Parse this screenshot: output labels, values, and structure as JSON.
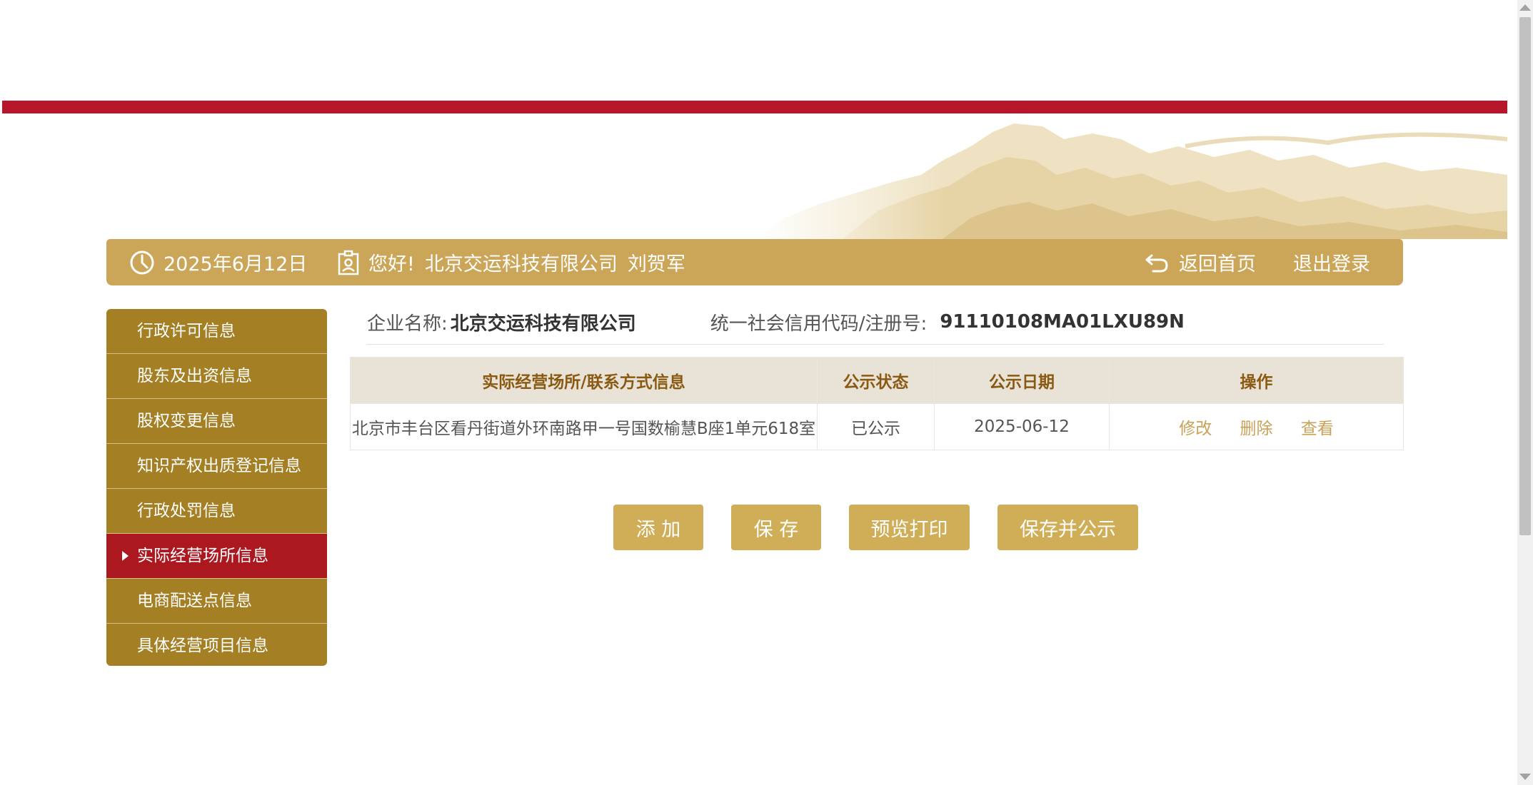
{
  "header": {
    "date": "2025年6月12日",
    "greeting": "您好!",
    "company": "北京交运科技有限公司",
    "user": "刘贺军",
    "home_label": "返回首页",
    "logout_label": "退出登录"
  },
  "sidebar": {
    "items": [
      {
        "label": "行政许可信息"
      },
      {
        "label": "股东及出资信息"
      },
      {
        "label": "股权变更信息"
      },
      {
        "label": "知识产权出质登记信息"
      },
      {
        "label": "行政处罚信息"
      },
      {
        "label": "实际经营场所信息"
      },
      {
        "label": "电商配送点信息"
      },
      {
        "label": "具体经营项目信息"
      }
    ],
    "active_index": 5
  },
  "company_info": {
    "name_label": "企业名称:",
    "name_value": "北京交运科技有限公司",
    "code_label": "统一社会信用代码/注册号:",
    "code_value": "91110108MA01LXU89N"
  },
  "table": {
    "headers": [
      "实际经营场所/联系方式信息",
      "公示状态",
      "公示日期",
      "操作"
    ],
    "rows": [
      {
        "address": "北京市丰台区看丹街道外环南路甲一号国数榆慧B座1单元618室",
        "status": "已公示",
        "date": "2025-06-12",
        "ops": [
          "修改",
          "删除",
          "查看"
        ]
      }
    ]
  },
  "buttons": {
    "add": "添 加",
    "save": "保 存",
    "preview": "预览打印",
    "save_publish": "保存并公示"
  },
  "colors": {
    "brand_red": "#b8162b",
    "gold": "#cca658",
    "sidebar": "#a57f24",
    "active": "#ab1820"
  }
}
